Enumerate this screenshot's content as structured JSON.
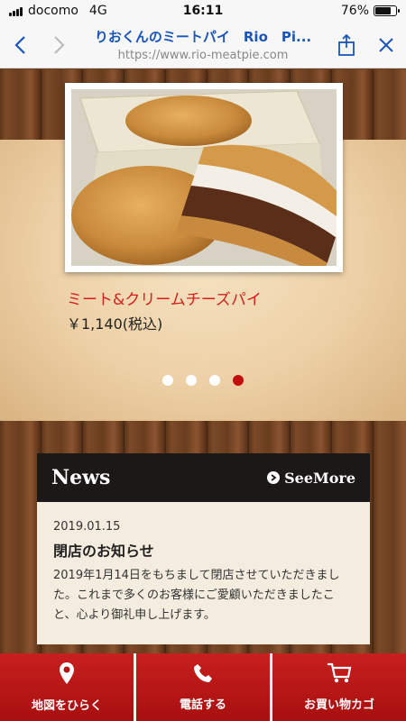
{
  "status_bar": {
    "carrier": "docomo",
    "network": "4G",
    "time": "16:11",
    "battery_percent": "76%",
    "battery_level": 0.76
  },
  "browser": {
    "page_title": "りおくんのミートパイ　Rio　Pi...",
    "url": "https://www.rio-meatpie.com",
    "icons": [
      "back-icon",
      "forward-icon",
      "share-icon",
      "close-icon"
    ]
  },
  "carousel": {
    "caption": "ミート&クリームチーズパイ",
    "price": "￥1,140(税込)",
    "slide_count": 4,
    "active_slide": 4
  },
  "news": {
    "title": "News",
    "see_more_label": "SeeMore",
    "items": [
      {
        "date": "2019.01.15",
        "headline": "閉店のお知らせ",
        "text": "2019年1月14日をもちまして閉店させていただきました。これまで多くのお客様にご愛顧いただきましたこと、心より御礼申し上げます。"
      }
    ]
  },
  "bottom_bar": {
    "buttons": [
      {
        "label": "地図をひらく",
        "icon": "map-pin-icon"
      },
      {
        "label": "電話する",
        "icon": "phone-icon"
      },
      {
        "label": "お買い物カゴ",
        "icon": "cart-icon"
      }
    ]
  },
  "colors": {
    "accent_red": "#c40d0d",
    "link_blue": "#1a55b9",
    "news_header_bg": "#1c1817"
  }
}
